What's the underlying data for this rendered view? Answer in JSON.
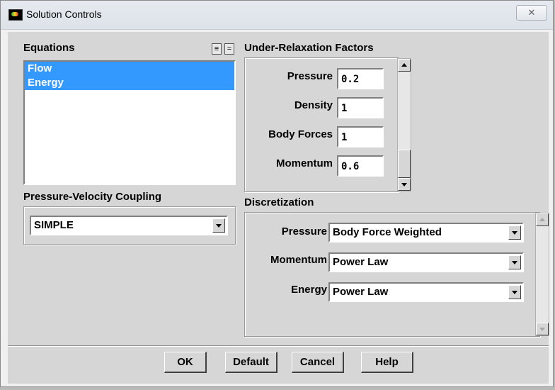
{
  "window": {
    "title": "Solution Controls",
    "close_glyph": "✕"
  },
  "equations": {
    "label": "Equations",
    "items": [
      "Flow",
      "Energy"
    ],
    "select_all_glyph": "≡",
    "deselect_glyph": "="
  },
  "urf": {
    "label": "Under-Relaxation Factors",
    "fields": [
      {
        "label": "Pressure",
        "value": "0.2"
      },
      {
        "label": "Density",
        "value": "1"
      },
      {
        "label": "Body Forces",
        "value": "1"
      },
      {
        "label": "Momentum",
        "value": "0.6"
      }
    ]
  },
  "pvc": {
    "label": "Pressure-Velocity Coupling",
    "value": "SIMPLE"
  },
  "discretization": {
    "label": "Discretization",
    "rows": [
      {
        "label": "Pressure",
        "value": "Body Force Weighted"
      },
      {
        "label": "Momentum",
        "value": "Power Law"
      },
      {
        "label": "Energy",
        "value": "Power Law"
      }
    ]
  },
  "buttons": {
    "ok": "OK",
    "default": "Default",
    "cancel": "Cancel",
    "help": "Help"
  },
  "colors": {
    "selection": "#3399ff",
    "dialog_bg": "#d6d6d6"
  },
  "icons": {
    "app": "fluent-app-icon",
    "close": "close-icon"
  }
}
